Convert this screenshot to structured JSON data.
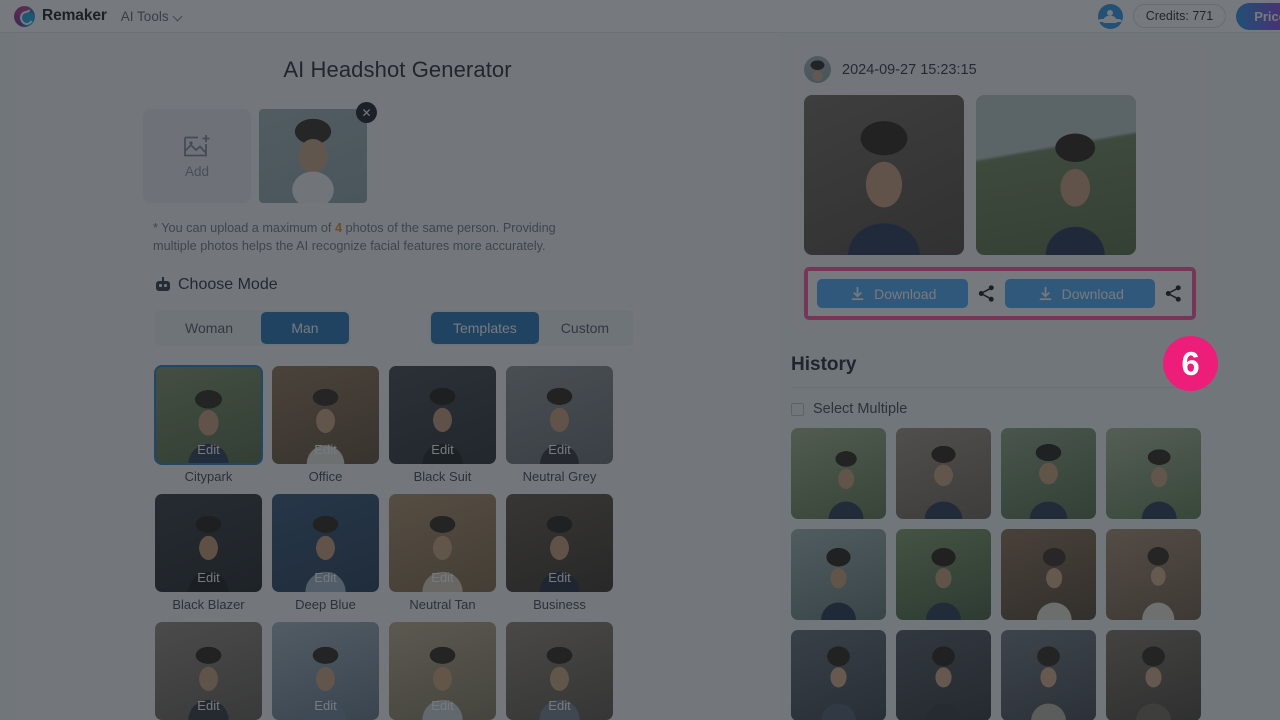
{
  "header": {
    "brand": "Remaker",
    "nav": "AI Tools",
    "credits": "Credits: 771",
    "price_label": "Price",
    "logo_icon": "remaker-logo-icon",
    "chevron_icon": "chevron-down-icon",
    "people_icon": "people-icon"
  },
  "left": {
    "title": "AI Headshot Generator",
    "add_label": "Add",
    "add_icon": "image-plus-icon",
    "close_icon": "close-icon",
    "hint_prefix": "* You can upload a maximum of ",
    "hint_max": "4",
    "hint_suffix": " photos of the same person. Providing multiple photos helps the AI recognize facial features more accurately.",
    "mode_heading": "Choose Mode",
    "mode_icon": "robot-icon",
    "gender_options": [
      "Woman",
      "Man"
    ],
    "gender_selected": "Man",
    "source_options": [
      "Templates",
      "Custom"
    ],
    "source_selected": "Templates",
    "edit_label": "Edit",
    "templates": [
      {
        "name": "Citypark",
        "selected": true,
        "img": "citypark"
      },
      {
        "name": "Office",
        "selected": false,
        "img": "office"
      },
      {
        "name": "Black Suit",
        "selected": false,
        "img": "blacksuit"
      },
      {
        "name": "Neutral Grey",
        "selected": false,
        "img": "neutralgrey"
      },
      {
        "name": "Black Blazer",
        "selected": false,
        "img": "blackblazer"
      },
      {
        "name": "Deep Blue",
        "selected": false,
        "img": "deepblue"
      },
      {
        "name": "Neutral Tan",
        "selected": false,
        "img": "neutraltan"
      },
      {
        "name": "Business",
        "selected": false,
        "img": "business"
      },
      {
        "name": "",
        "selected": false,
        "img": "row3a"
      },
      {
        "name": "",
        "selected": false,
        "img": "row3b"
      },
      {
        "name": "",
        "selected": false,
        "img": "row3c"
      },
      {
        "name": "",
        "selected": false,
        "img": "row3d"
      }
    ]
  },
  "right": {
    "timestamp": "2024-09-27 15:23:15",
    "avatar_icon": "user-avatar",
    "download_label": "Download",
    "download_icon": "download-icon",
    "share_icon": "share-icon",
    "history_title": "History",
    "select_multiple_label": "Select Multiple",
    "toggle_on": true,
    "history_thumbs": [
      "m-park-1",
      "m-park-2",
      "m-park-3",
      "m-park-4",
      "m-city-1",
      "m-green-1",
      "f-office-1",
      "f-office-2",
      "f-dark-1",
      "f-dark-2",
      "f-dark-3",
      "f-dark-4"
    ]
  },
  "annotation": {
    "step_badge": "6",
    "highlight_color": "#fb4e9c",
    "badge_color": "#ec1e79"
  }
}
